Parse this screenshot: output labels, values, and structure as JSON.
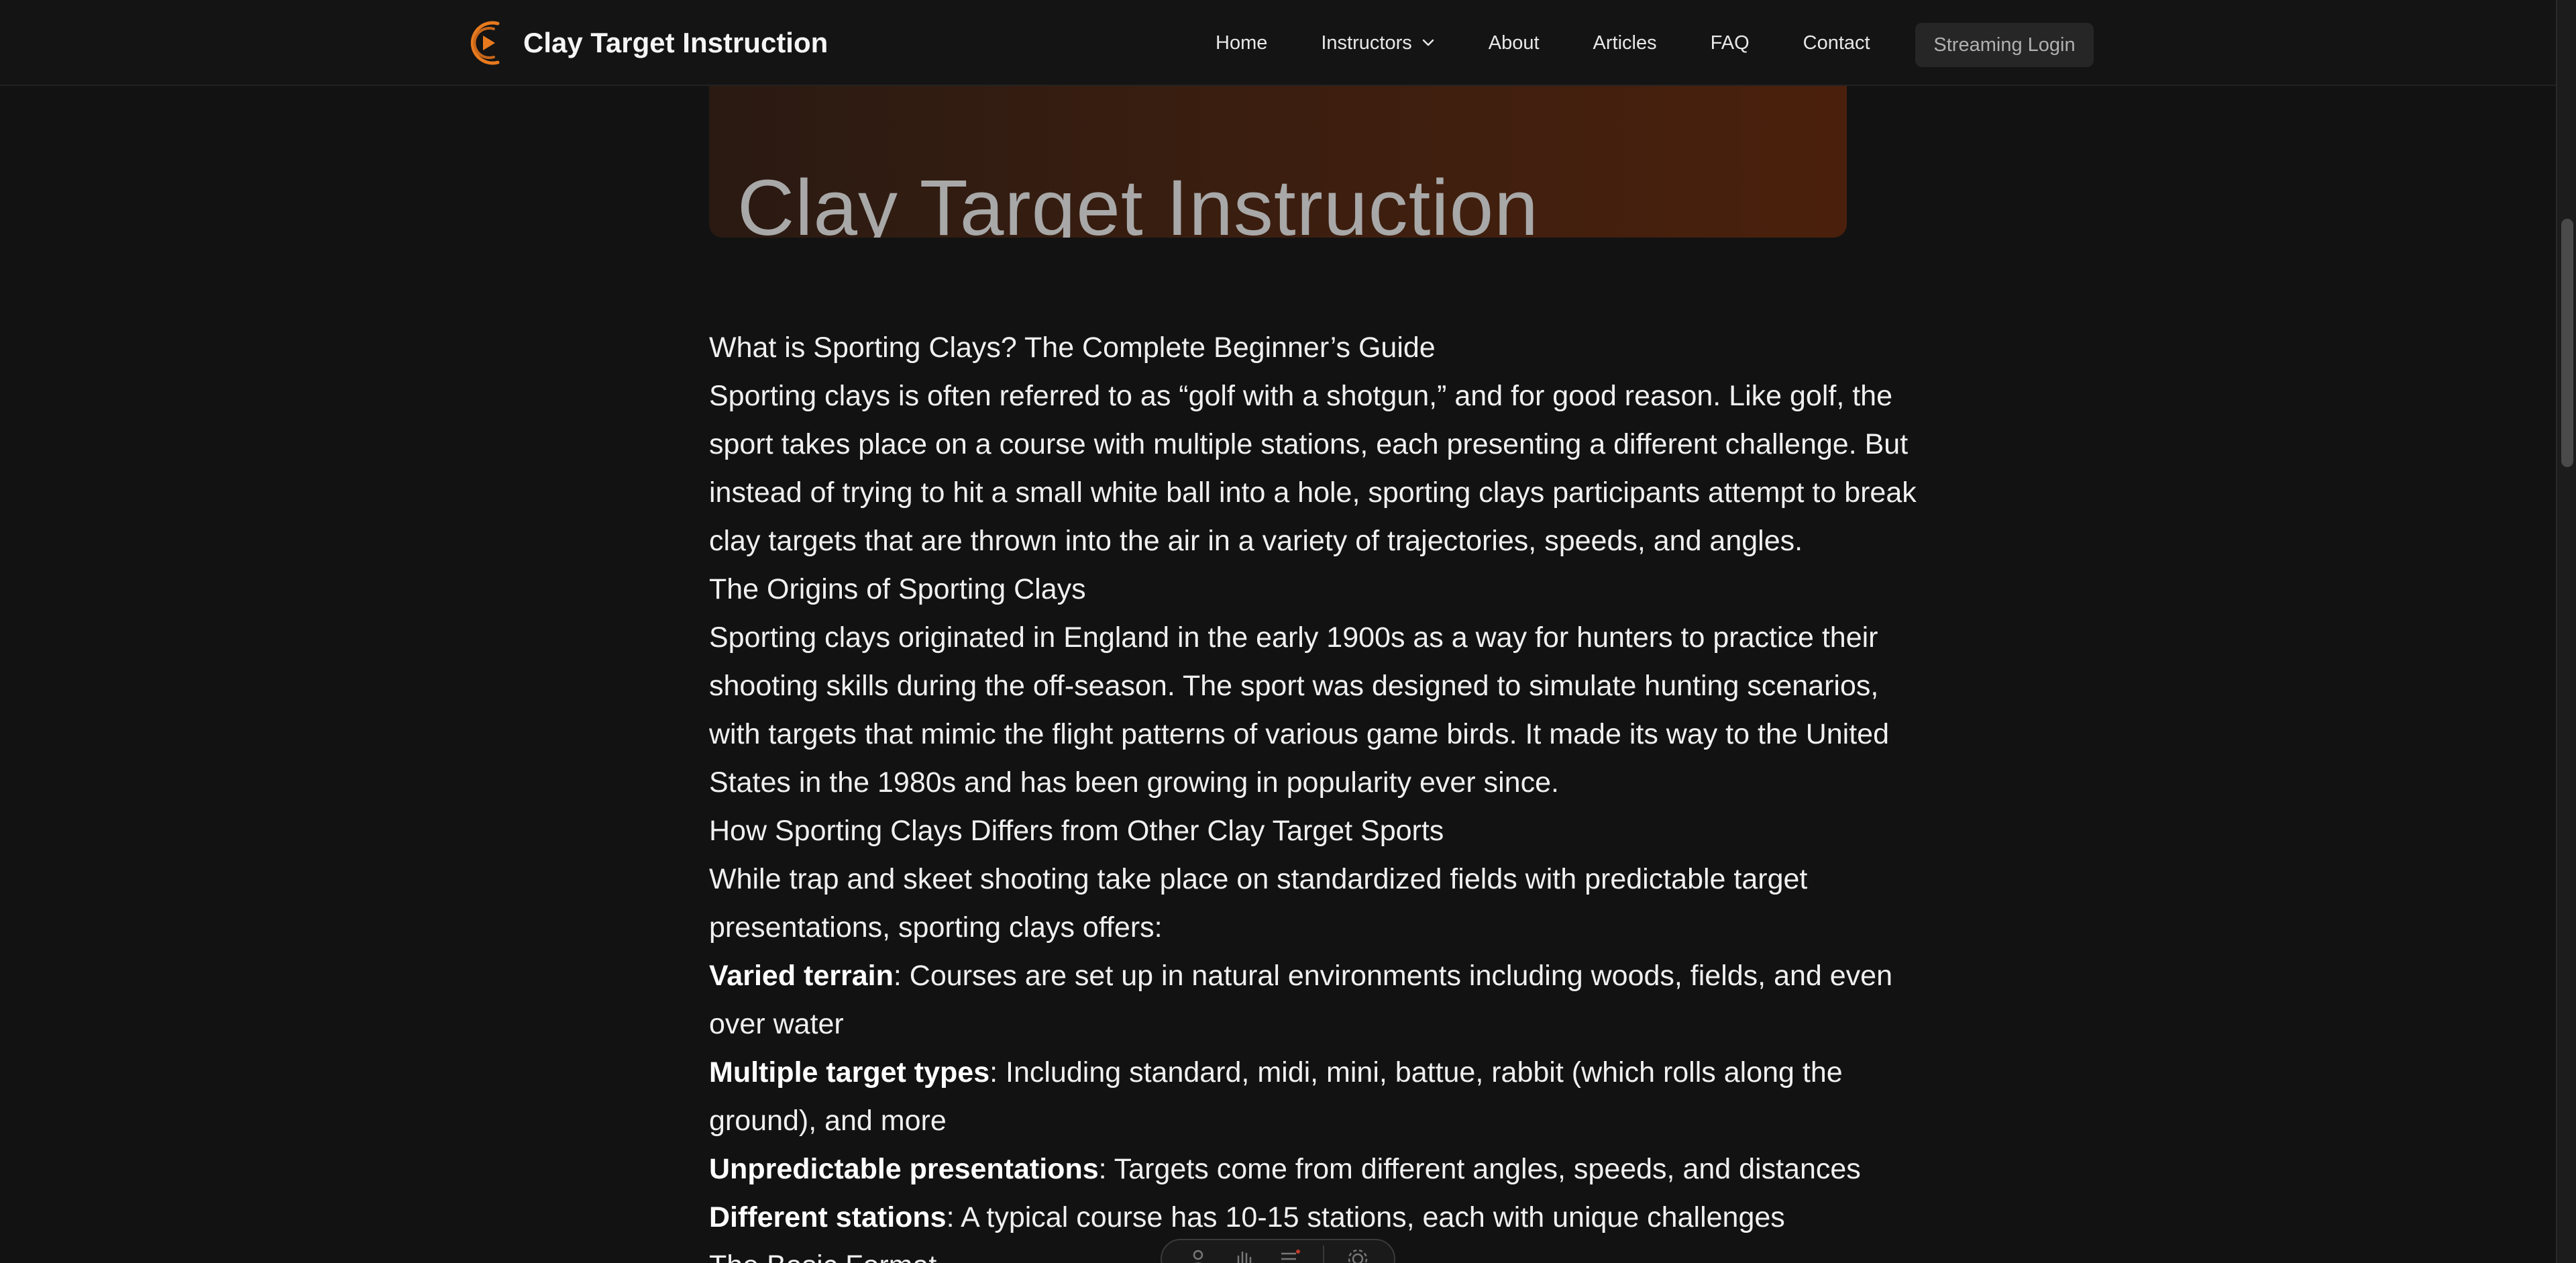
{
  "header": {
    "brand_name": "Clay Target Instruction",
    "brand_logo_icon": "play-arc-logo-icon",
    "nav": {
      "home": "Home",
      "instructors": "Instructors",
      "about": "About",
      "articles": "Articles",
      "faq": "FAQ",
      "contact": "Contact"
    },
    "login_label": "Streaming Login"
  },
  "hero": {
    "title": "Clay Target Instruction"
  },
  "article": {
    "title": "What is Sporting Clays? The Complete Beginner’s Guide",
    "intro_lines": [
      "Sporting clays is often referred to as “golf with a shotgun,” and for good reason. Like golf, the",
      "sport takes place on a course with multiple stations, each presenting a different challenge. But",
      "instead of trying to hit a small white ball into a hole, sporting clays participants attempt to break",
      "clay targets that are thrown into the air in a variety of trajectories, speeds, and angles."
    ],
    "origins_heading": "The Origins of Sporting Clays",
    "origins_lines": [
      "Sporting clays originated in England in the early 1900s as a way for hunters to practice their",
      "shooting skills during the off-season. The sport was designed to simulate hunting scenarios,",
      "with targets that mimic the flight patterns of various game birds. It made its way to the United",
      "States in the 1980s and has been growing in popularity ever since."
    ],
    "differs_heading": "How Sporting Clays Differs from Other Clay Target Sports",
    "differs_lines": [
      "While trap and skeet shooting take place on standardized fields with predictable target",
      "presentations, sporting clays offers:"
    ],
    "features": [
      {
        "term": "Varied terrain",
        "text_1": ": Courses are set up in natural environments including woods, fields, and even",
        "text_2": "over water"
      },
      {
        "term": "Multiple target types",
        "text_1": ": Including standard, midi, mini, battue, rabbit (which rolls along the",
        "text_2": "ground), and more"
      },
      {
        "term": "Unpredictable presentations",
        "text_1": ": Targets come from different angles, speeds, and distances"
      },
      {
        "term": "Different stations",
        "text_1": ": A typical course has 10-15 stations, each with unique challenges"
      }
    ],
    "next_heading_partial": "The Basic Format"
  },
  "colors": {
    "background": "#121212",
    "header": "#141414",
    "accent_orange": "#e87a1e",
    "hero_gradient_end": "#4a200c"
  }
}
